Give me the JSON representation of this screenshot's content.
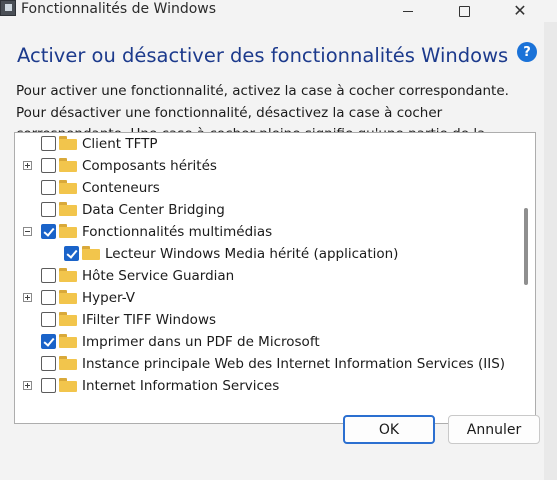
{
  "window": {
    "title": "Fonctionnalités de Windows",
    "controls": [
      "minimize",
      "maximize",
      "close"
    ],
    "close_glyph": "✕"
  },
  "header": {
    "heading": "Activer ou désactiver des fonctionnalités Windows",
    "help": "?"
  },
  "description": "Pour activer une fonctionnalité, activez la case à cocher correspondante. Pour désactiver une fonctionnalité, désactivez la case à cocher correspondante. Une case à cocher pleine signifie qu'une partie de la fonctionnalité est activée.",
  "features": [
    {
      "label": "Client TFTP",
      "checked": false,
      "expander": "none",
      "level": 0
    },
    {
      "label": "Composants hérités",
      "checked": false,
      "expander": "plus",
      "level": 0
    },
    {
      "label": "Conteneurs",
      "checked": false,
      "expander": "none",
      "level": 0
    },
    {
      "label": "Data Center Bridging",
      "checked": false,
      "expander": "none",
      "level": 0
    },
    {
      "label": "Fonctionnalités multimédias",
      "checked": true,
      "expander": "minus",
      "level": 0
    },
    {
      "label": "Lecteur Windows Media hérité (application)",
      "checked": true,
      "expander": "none",
      "level": 1
    },
    {
      "label": "Hôte Service Guardian",
      "checked": false,
      "expander": "none",
      "level": 0
    },
    {
      "label": "Hyper-V",
      "checked": false,
      "expander": "plus",
      "level": 0
    },
    {
      "label": "IFilter TIFF Windows",
      "checked": false,
      "expander": "none",
      "level": 0
    },
    {
      "label": "Imprimer dans un PDF de Microsoft",
      "checked": true,
      "expander": "none",
      "level": 0
    },
    {
      "label": "Instance principale Web des Internet Information Services (IIS)",
      "checked": false,
      "expander": "none",
      "level": 0
    },
    {
      "label": "Internet Information Services",
      "checked": false,
      "expander": "plus",
      "level": 0
    }
  ],
  "buttons": {
    "ok": "OK",
    "cancel": "Annuler"
  },
  "colors": {
    "heading": "#1c3a8c",
    "accent": "#1a63c9",
    "folder": "#f2c54c"
  }
}
